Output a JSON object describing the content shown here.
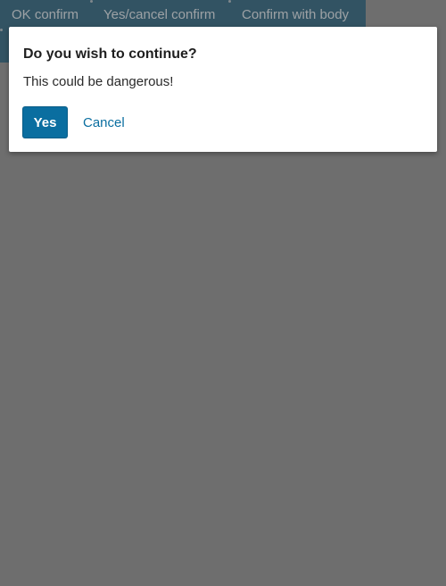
{
  "toolbar": {
    "buttons": [
      {
        "label": "OK confirm"
      },
      {
        "label": "Yes/cancel confirm"
      },
      {
        "label": "Confirm with body"
      }
    ]
  },
  "dialog": {
    "title": "Do you wish to continue?",
    "body": "This could be dangerous!",
    "confirm_label": "Yes",
    "cancel_label": "Cancel"
  },
  "colors": {
    "backdrop": "#7a7a7a",
    "toolbar": "#0d4a66",
    "primary_button": "#0a6ea0",
    "link": "#0a6ea0"
  }
}
